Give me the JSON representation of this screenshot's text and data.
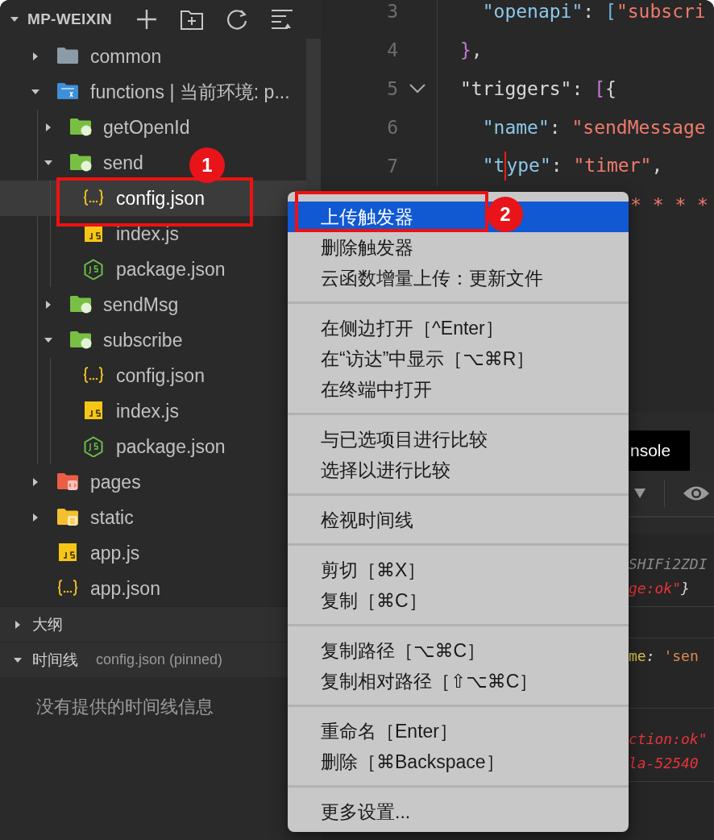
{
  "explorer": {
    "title": "MP-WEIXIN",
    "tree": [
      {
        "label": "common",
        "kind": "folder",
        "expanded": false,
        "selected": false
      },
      {
        "label": "functions | 当前环境: p...",
        "kind": "folder-functions",
        "expanded": true,
        "selected": false,
        "children": [
          {
            "label": "getOpenId",
            "kind": "folder-cloud",
            "expanded": false,
            "selected": false
          },
          {
            "label": "send",
            "kind": "folder-cloud",
            "expanded": true,
            "selected": false,
            "children": [
              {
                "label": "config.json",
                "kind": "json",
                "selected": true
              },
              {
                "label": "index.js",
                "kind": "js",
                "selected": false
              },
              {
                "label": "package.json",
                "kind": "package",
                "selected": false
              }
            ]
          },
          {
            "label": "sendMsg",
            "kind": "folder-cloud",
            "expanded": false,
            "selected": false
          },
          {
            "label": "subscribe",
            "kind": "folder-cloud",
            "expanded": true,
            "selected": false,
            "children": [
              {
                "label": "config.json",
                "kind": "json",
                "selected": false
              },
              {
                "label": "index.js",
                "kind": "js",
                "selected": false
              },
              {
                "label": "package.json",
                "kind": "package",
                "selected": false
              }
            ]
          }
        ]
      },
      {
        "label": "pages",
        "kind": "folder-pages",
        "expanded": false,
        "selected": false
      },
      {
        "label": "static",
        "kind": "folder-static",
        "expanded": false,
        "selected": false
      },
      {
        "label": "app.js",
        "kind": "js",
        "selected": false
      },
      {
        "label": "app.json",
        "kind": "json",
        "selected": false
      }
    ]
  },
  "sections": [
    {
      "label": "大纲",
      "expanded": false
    },
    {
      "label": "时间线",
      "expanded": true,
      "detail": "config.json (pinned)",
      "message": "没有提供的时间线信息"
    }
  ],
  "editor": {
    "lines": [
      {
        "kind": "code",
        "number": "3",
        "tokens": [
          {
            "text": "  \"openapi\"",
            "kind": "key"
          },
          {
            "text": ": ",
            "kind": "plain"
          },
          {
            "text": "[",
            "kind": "bracket"
          },
          {
            "text": "\"subscri",
            "kind": "string"
          }
        ]
      },
      {
        "kind": "code",
        "number": "4",
        "tokens": [
          {
            "text": "}",
            "kind": "brace"
          },
          {
            "text": ",",
            "kind": "plain"
          }
        ]
      },
      {
        "kind": "code",
        "number": "5",
        "foldable": true,
        "tokens": [
          {
            "text": "\"triggers\"",
            "kind": "key-plain"
          },
          {
            "text": ": ",
            "kind": "plain"
          },
          {
            "text": "[",
            "kind": "brace"
          },
          {
            "text": "{",
            "kind": "plain"
          }
        ]
      },
      {
        "kind": "code",
        "number": "6",
        "tokens": [
          {
            "text": "  \"name\"",
            "kind": "key"
          },
          {
            "text": ": ",
            "kind": "plain"
          },
          {
            "text": "\"sendMessage",
            "kind": "string"
          }
        ]
      },
      {
        "kind": "code",
        "number": "7",
        "tokens": [
          {
            "text": "  \"t",
            "kind": "key"
          },
          {
            "text": "ype\"",
            "kind": "key",
            "cursor": true
          },
          {
            "text": ": ",
            "kind": "plain"
          },
          {
            "text": "\"timer\"",
            "kind": "string"
          },
          {
            "text": ",",
            "kind": "plain"
          }
        ]
      },
      {
        "kind": "partial",
        "tokens": [
          {
            "text": "* * * *",
            "kind": "string"
          }
        ]
      }
    ]
  },
  "panel": {
    "tab": {
      "label": "nsole",
      "selected": true
    },
    "entries": [
      {
        "lines": [
          [
            {
              "text": "SHIFi2ZDI",
              "kind": "muted"
            }
          ],
          [
            {
              "text": "ge:ok\"",
              "kind": "error"
            },
            {
              "text": "}",
              "kind": "plain"
            }
          ]
        ]
      },
      {
        "lines": [
          [
            {
              "text": "me",
              "kind": "prop"
            },
            {
              "text": ": ",
              "kind": "plain"
            },
            {
              "text": "'sen",
              "kind": "str"
            }
          ]
        ]
      },
      {
        "lines": [
          [
            {
              "text": "ction:ok\"",
              "kind": "error"
            }
          ],
          [
            {
              "text": "la-52540",
              "kind": "error"
            }
          ]
        ]
      }
    ]
  },
  "context_menu": {
    "groups": [
      [
        {
          "label": "上传触发器",
          "selected": true
        },
        {
          "label": "删除触发器",
          "selected": false
        },
        {
          "label": "云函数增量上传：更新文件",
          "selected": false
        }
      ],
      [
        {
          "label": "在侧边打开［^Enter］",
          "selected": false
        },
        {
          "label": "在“访达”中显示［⌥⌘R］",
          "selected": false
        },
        {
          "label": "在终端中打开",
          "selected": false
        }
      ],
      [
        {
          "label": "与已选项目进行比较",
          "selected": false
        },
        {
          "label": "选择以进行比较",
          "selected": false
        }
      ],
      [
        {
          "label": "检视时间线",
          "selected": false
        }
      ],
      [
        {
          "label": "剪切［⌘X］",
          "selected": false
        },
        {
          "label": "复制［⌘C］",
          "selected": false
        }
      ],
      [
        {
          "label": "复制路径［⌥⌘C］",
          "selected": false
        },
        {
          "label": "复制相对路径［⇧⌥⌘C］",
          "selected": false
        }
      ],
      [
        {
          "label": "重命名［Enter］",
          "selected": false
        },
        {
          "label": "删除［⌘Backspace］",
          "selected": false
        }
      ],
      [
        {
          "label": "更多设置...",
          "selected": false
        }
      ]
    ]
  },
  "annotations": [
    {
      "number": "1"
    },
    {
      "number": "2"
    }
  ]
}
